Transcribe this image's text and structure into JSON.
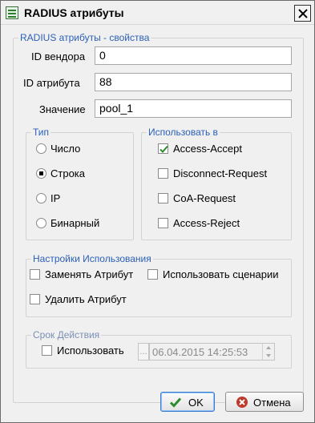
{
  "window": {
    "title": "RADIUS атрибуты"
  },
  "properties": {
    "legend": "RADIUS атрибуты - свойства",
    "vendor_label": "ID вендора",
    "vendor_value": "0",
    "attr_label": "ID атрибута",
    "attr_value": "88",
    "value_label": "Значение",
    "value_value": "pool_1"
  },
  "type_group": {
    "legend": "Тип",
    "options": [
      "Число",
      "Строка",
      "IP",
      "Бинарный"
    ],
    "selected": "Строка"
  },
  "use_in": {
    "legend": "Использовать в",
    "options": [
      {
        "label": "Access-Accept",
        "checked": true
      },
      {
        "label": "Disconnect-Request",
        "checked": false
      },
      {
        "label": "CoA-Request",
        "checked": false
      },
      {
        "label": "Access-Reject",
        "checked": false
      }
    ]
  },
  "usage_settings": {
    "legend": "Настройки Использования",
    "replace_label": "Заменять Атрибут",
    "scripts_label": "Использовать сценарии",
    "delete_label": "Удалить Атрибут"
  },
  "validity": {
    "legend": "Срок Действия",
    "use_label": "Использовать",
    "dots_label": "...",
    "datetime": "06.04.2015 14:25:53"
  },
  "buttons": {
    "ok": "OK",
    "cancel": "Отмена"
  },
  "colors": {
    "accent": "#2b5fb5",
    "check": "#2e8b2e",
    "cancel_icon": "#c0392b"
  }
}
